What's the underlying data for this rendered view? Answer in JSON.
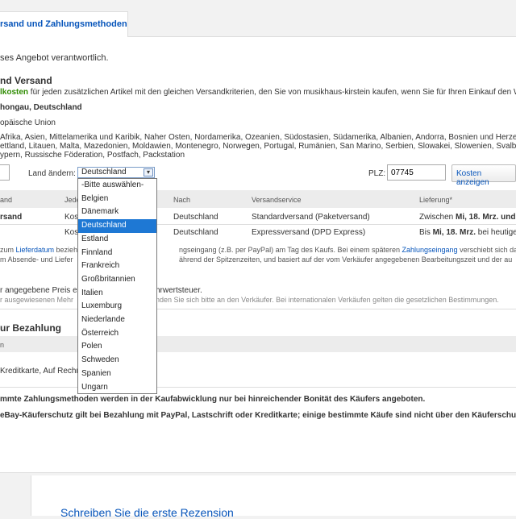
{
  "tab": {
    "label": "rsand und Zahlungsmethoden"
  },
  "intro": "ses Angebot verantwortlich.",
  "shipping": {
    "heading": "nd Versand",
    "combined_label": "lkosten",
    "combined_text": " für jeden zusätzlichen Artikel mit den gleichen Versandkriterien, den Sie von musikhaus-kirstein kaufen, wenn Sie für Ihren Einkauf den Wa",
    "location": "hongau, Deutschland",
    "ships_to": "opäische Union",
    "excluded_line1": "Afrika, Asien, Mittelamerika und Karibik, Naher Osten, Nordamerika, Ozeanien, Südostasien, Südamerika, Albanien, Andorra, Bosnien und Herzeg",
    "excluded_line2": "ettland, Litauen, Malta, Mazedonien, Moldawien, Montenegro, Norwegen, Portugal, Rumänien, San Marino, Serbien, Slowakei, Slowenien, Svalbar",
    "excluded_line3": "ypern, Russische Föderation, Postfach, Packstation"
  },
  "controls": {
    "quantity_value": "",
    "country_label": "Land ändern:",
    "country_selected": "Deutschland",
    "plz_label": "PLZ:",
    "plz_value": "07745",
    "calc_button": "Kosten anzeigen"
  },
  "table": {
    "headers": [
      "and",
      "Jede",
      "Nach",
      "Versandservice",
      "Lieferung*"
    ],
    "rows": [
      {
        "c1": "rsand",
        "c2": "Kos",
        "to": "Deutschland",
        "service": "Standardversand (Paketversand)",
        "delivery_pre": "Zwischen ",
        "delivery_bold": "Mi, 18. Mrz. und"
      },
      {
        "c1": "",
        "c2": "Kos",
        "to": "Deutschland",
        "service": "Expressversand (DPD Express)",
        "delivery_pre": "Bis ",
        "delivery_bold": "Mi, 18. Mrz.",
        "delivery_post": " bei heutige"
      }
    ]
  },
  "notes": {
    "n1_a": "zum ",
    "n1_link": "Lieferdatum",
    "n1_b": " bezieh",
    "n1_c": "ngseingang (z.B. per PayPal) am Tag des Kaufs. Bei einem späteren ",
    "n1_link2": "Zahlungseingang",
    "n1_d": " verschiebt sich das L",
    "n2_a": "m Absende- und Liefer",
    "n2_b": "ährend der Spitzenzeiten, und basiert auf der vom Verkäufer angegebenen Bearbeitungszeit und der au",
    "price_a": "r angegebene Preis ent",
    "price_b": "hrwertsteuer.",
    "price2_a": "r ausgewiesenen Mehr",
    "price2_b": "nden Sie sich bitte an den Verkäufer. Bei internationalen Verkäufen gelten die gesetzlichen Bestimmungen."
  },
  "payment": {
    "heading": "ur Bezahlung",
    "header": "n",
    "methods": "Kreditkarte, Auf Rechn",
    "note1": "mmte Zahlungsmethoden werden in der Kaufabwicklung nur bei hinreichender Bonität des Käufers angeboten.",
    "note2": "eBay-Käuferschutz gilt bei Bezahlung mit PayPal, Lastschrift oder Kreditkarte; einige bestimmte Käufe sind nicht über den Käuferschu"
  },
  "dropdown": {
    "options": [
      "-Bitte auswählen-",
      "Belgien",
      "Dänemark",
      "Deutschland",
      "Estland",
      "Finnland",
      "Frankreich",
      "Großbritannien",
      "Italien",
      "Luxemburg",
      "Niederlande",
      "Österreich",
      "Polen",
      "Schweden",
      "Spanien",
      "Ungarn"
    ],
    "selected_index": 3
  },
  "review": {
    "link": "Schreiben Sie die erste Rezension"
  },
  "colors": {
    "link": "#0654ba",
    "green": "#2e8b00",
    "highlight": "#1e78d4"
  }
}
